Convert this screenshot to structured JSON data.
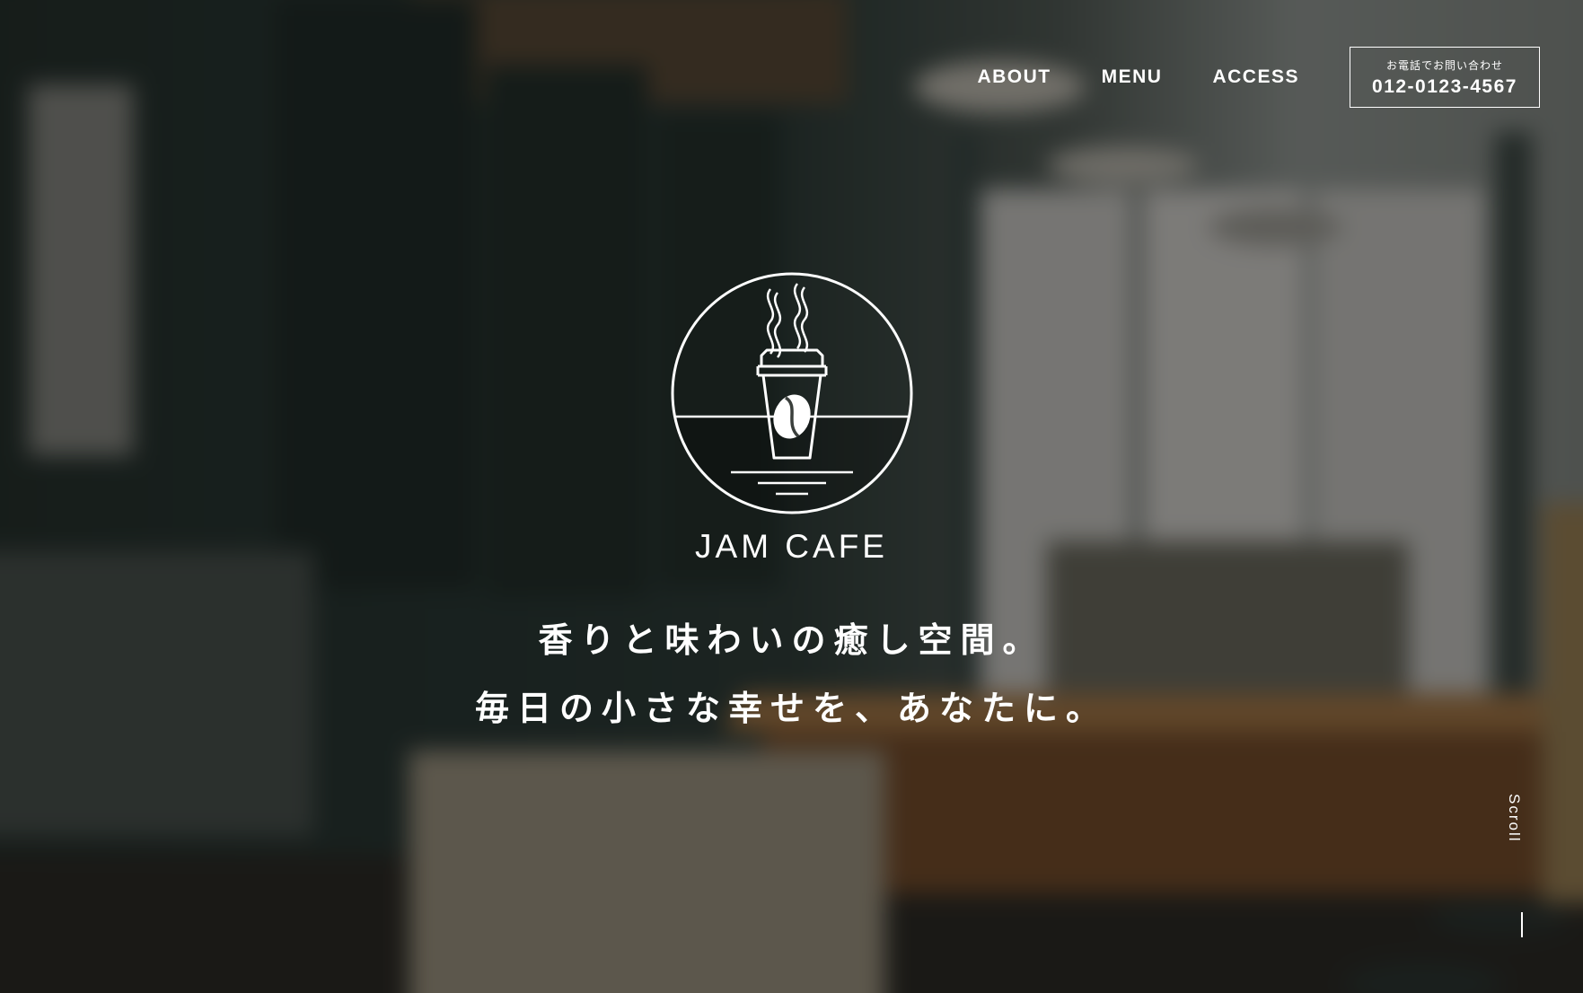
{
  "nav": {
    "items": [
      {
        "label": "ABOUT"
      },
      {
        "label": "MENU"
      },
      {
        "label": "ACCESS"
      }
    ]
  },
  "contact": {
    "label": "お電話でお問い合わせ",
    "phone": "012-0123-4567"
  },
  "hero": {
    "logo_icon": "coffee-cup-icon",
    "brand": "JAM CAFE",
    "tagline_line1": "香りと味わいの癒し空間。",
    "tagline_line2": "毎日の小さな幸せを、あなたに。"
  },
  "scroll": {
    "label": "Scroll"
  },
  "colors": {
    "text": "#ffffff",
    "overlay": "#0a0e0c"
  }
}
